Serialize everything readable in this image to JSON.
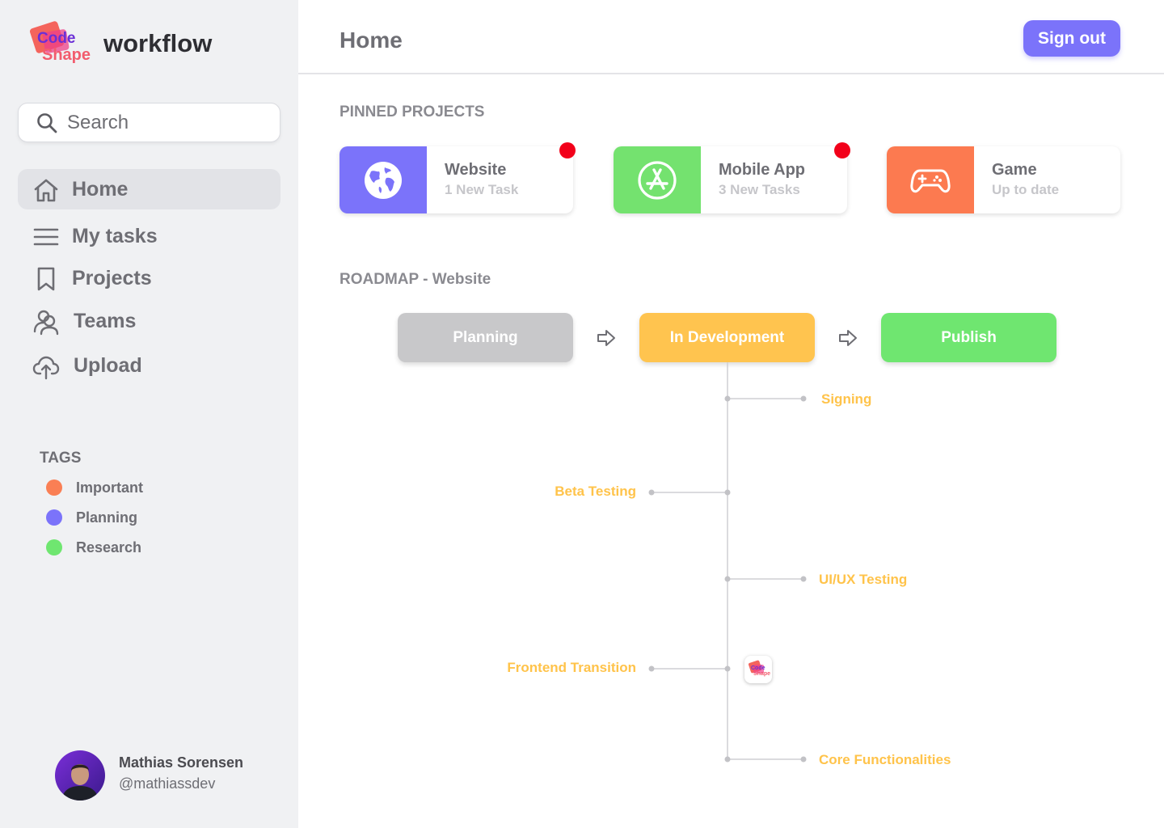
{
  "app": {
    "brand_logo_text": [
      "Code",
      "Shape"
    ],
    "brand_word": "workflow"
  },
  "search": {
    "placeholder": "Search"
  },
  "nav": {
    "items": [
      {
        "label": "Home",
        "icon": "home-icon",
        "active": true
      },
      {
        "label": "My tasks",
        "icon": "menu-icon"
      },
      {
        "label": "Projects",
        "icon": "bookmark-icon"
      },
      {
        "label": "Teams",
        "icon": "users-icon"
      },
      {
        "label": "Upload",
        "icon": "cloud-upload-icon"
      }
    ]
  },
  "tags": {
    "title": "TAGS",
    "items": [
      {
        "label": "Important",
        "color": "#fa7f54"
      },
      {
        "label": "Planning",
        "color": "#7b73fa"
      },
      {
        "label": "Research",
        "color": "#6fe670"
      }
    ]
  },
  "user": {
    "name": "Mathias Sorensen",
    "handle": "@mathiassdev"
  },
  "header": {
    "title": "Home",
    "signout_label": "Sign out"
  },
  "pinned": {
    "title": "PINNED PROJECTS",
    "projects": [
      {
        "name": "Website",
        "status": "1 New Task",
        "color": "#7b73fa",
        "icon": "globe-icon",
        "notification": true
      },
      {
        "name": "Mobile App",
        "status": "3 New Tasks",
        "color": "#74e26f",
        "icon": "app-store-icon",
        "notification": true
      },
      {
        "name": "Game",
        "status": "Up to date",
        "color": "#fc7a50",
        "icon": "gamepad-icon",
        "notification": false
      }
    ]
  },
  "roadmap": {
    "title": "ROADMAP - Website",
    "stages": [
      {
        "label": "Planning",
        "color": "#c8c8ca"
      },
      {
        "label": "In Development",
        "color": "#ffc44f"
      },
      {
        "label": "Publish",
        "color": "#6fe670"
      }
    ],
    "milestones": [
      "Signing",
      "Beta Testing",
      "UI/UX Testing",
      "Frontend Transition",
      "Core Functionalities"
    ],
    "accent": "#ffc34a"
  }
}
